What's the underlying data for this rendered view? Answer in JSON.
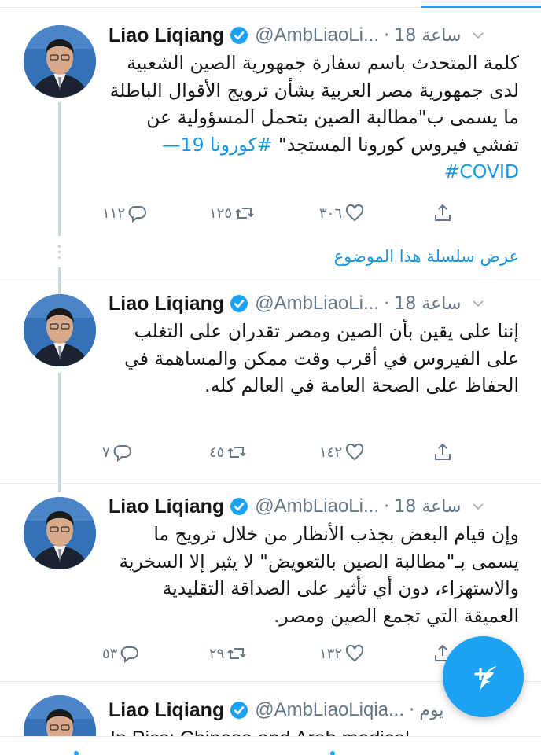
{
  "accent_color": "#1da1f2",
  "tweets": [
    {
      "author": "Liao Liqiang",
      "handle": "@AmbLiaoLi...",
      "dot": "·",
      "time": "18 ساعة",
      "text": "كلمة المتحدث باسم سفارة جمهورية الصين الشعبية لدى جمهورية مصر العربية بشأن ترويج الأقوال الباطلة ما يسمى ب\"مطالبة الصين بتحمل المسؤولية عن تفشي فيروس كورونا المستجد\"",
      "hashtags": "#كورونا 19—COVID#",
      "replies": "١١٢",
      "retweets": "١٢٥",
      "likes": "٣٠٦",
      "icons": {
        "verified": "verified-badge-icon",
        "menu": "chevron-down-icon"
      }
    },
    {
      "author": "Liao Liqiang",
      "handle": "@AmbLiaoLi...",
      "dot": "·",
      "time": "18 ساعة",
      "text": "إننا على يقين بأن الصين ومصر تقدران على التغلب على الفيروس في أقرب وقت ممكن والمساهمة في الحفاظ على الصحة العامة في العالم كله.",
      "replies": "٧",
      "retweets": "٤٥",
      "likes": "١٤٢"
    },
    {
      "author": "Liao Liqiang",
      "handle": "@AmbLiaoLi...",
      "dot": "·",
      "time": "18 ساعة",
      "text": "وإن قيام البعض بجذب الأنظار من خلال ترويج ما يسمى بـ\"مطالبة الصين بالتعويض\" لا يثير إلا السخرية والاستهزاء، دون أي تأثير على الصداقة التقليدية العميقة التي تجمع الصين ومصر.",
      "replies": "٥٣",
      "retweets": "٢٩",
      "likes": "١٣٢"
    },
    {
      "author": "Liao Liqiang",
      "handle": "@AmbLiaoLiqia...",
      "dot": "·",
      "time": "يوم",
      "text": "In Pics: Chinese and Arab medical"
    }
  ],
  "show_thread": "عرض سلسلة هذا الموضوع",
  "compose": {
    "icon": "compose-tweet-icon"
  }
}
